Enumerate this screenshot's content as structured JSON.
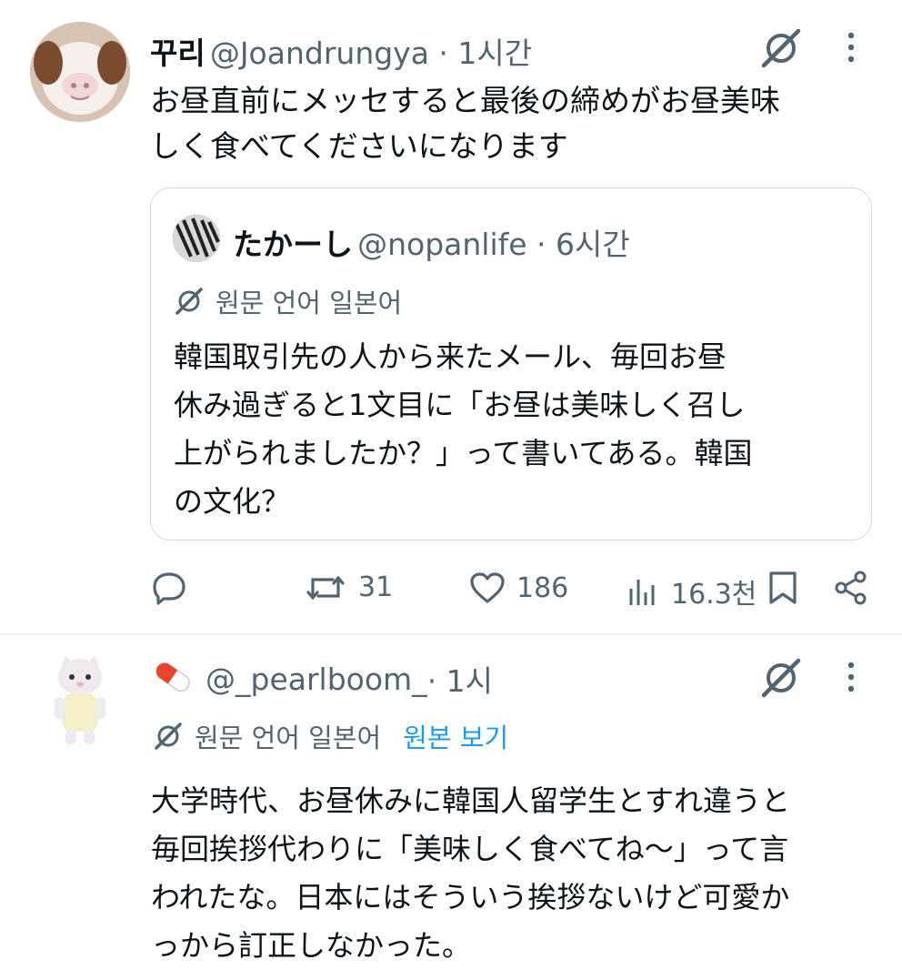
{
  "tweet1": {
    "display_name": "꾸리",
    "handle": "@Joandrungya",
    "time": " · 1시간",
    "text_line1": "お昼直前にメッセすると最後の締めがお昼美味",
    "text_line2": "しく食べてくださいになります",
    "avatar_icon": "guinea-pig-avatar",
    "stats": {
      "retweets": "31",
      "likes": "186",
      "views": "16.3천"
    }
  },
  "quote": {
    "display_name": "たかーし",
    "handle": "@nopanlife",
    "time": " · 6시간",
    "translate_label": "원문 언어 일본어",
    "text_line1": "韓国取引先の人から来たメール、毎回お昼",
    "text_line2": "休み過ぎると1文目に「お昼は美味しく召し",
    "text_line3": "上がられましたか？」って書いてある。韓国",
    "text_line4": "の文化？"
  },
  "tweet2": {
    "emoji_name": "💊",
    "handle": "@_pearlboom_",
    "time": " · 1시",
    "translate_label": "원문 언어 일본어",
    "translate_link": "원본 보기",
    "text_line1": "大学時代、お昼休みに韓国人留学生とすれ違うと",
    "text_line2": "毎回挨拶代わりに「美味しく食べてね〜」って言",
    "text_line3": "われたな。日本にはそういう挨拶ないけど可愛か",
    "text_line4": "っから訂正しなかった。",
    "avatar_icon": "cat-figure-avatar"
  },
  "colors": {
    "text": "#0f1419",
    "muted": "#536471",
    "link": "#1d9bf0",
    "border": "#cfd9de"
  }
}
